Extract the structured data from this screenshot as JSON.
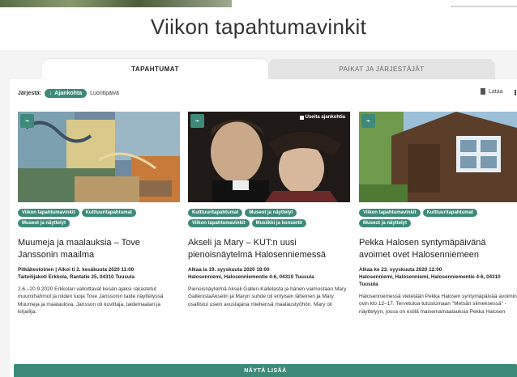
{
  "header": {
    "title": "Viikon tapahtumavinkit"
  },
  "tabs": [
    {
      "label": "TAPAHTUMAT",
      "active": true
    },
    {
      "label": "PAIKAT JA JÄRJESTÄJÄT",
      "active": false
    }
  ],
  "sort": {
    "label": "Järjestä:",
    "active_option": "Ajankohta",
    "other_option": "Luontipäivä"
  },
  "download": {
    "label": "Lataa"
  },
  "cards": [
    {
      "tags": [
        "Viikon tapahtumavinkit",
        "Kulttuuritapahtumat",
        "Museot ja näyttelyt"
      ],
      "title": "Muumeja ja maalauksia – Tove Janssonin maailma",
      "when": "Pitkäkestoinen | Alkoi ti 2. kesäkuuta 2020 11:00",
      "where": "Taiteilijakoti Erkkola, Rantatie 25, 04310 Tuusula",
      "description": "2.6.–20.9.2020 Erkkolan valloittavat kesän ajaksi rakastetut muumihahmot ja niiden luoja Tove Janssonin taide näyttelyssä Muumeja ja maalauksia. Jansson oli kuvittaja, taidemaalari ja kirjailija.",
      "badge": ""
    },
    {
      "tags": [
        "Kulttuuritapahtumat",
        "Museot ja näyttelyt",
        "Viikon tapahtumavinkit",
        "Musiikki ja konsertit"
      ],
      "title": "Akseli ja Mary – KUT:n uusi pienoisnäytelmä Halosenniemessä",
      "when": "Alkaa la 19. syyskuuta 2020 18:00",
      "where": "Halosenniemi, Halosenniementie 4-6, 04310 Tuusula",
      "description": "Pienoisnäytelmä Akseli Gallen-Kallelasta ja hänen vaimostaan Mary GallénistaAkselin ja Maryn suhde oli erityisen läheinen ja Mary osallistui usein avustajana miehensä maalaustyöhön. Mary oli",
      "badge": "Useita ajankohtia"
    },
    {
      "tags": [
        "Viikon tapahtumavinkit",
        "Kulttuuritapahtumat",
        "Museot ja näyttelyt"
      ],
      "title": "Pekka Halosen syntymäpäivänä avoimet ovet Halosenniemeen",
      "when": "Alkaa ke 23. syyskuuta 2020 12:00",
      "where": "Halosenniemi, Halosenniemi, Halosenniementie 4-6, 04310 Tuusula",
      "description": "Halosenniemessä vietetään Pekka Halosen syntymäpäivää avoimin ovin klo 12–17. Tervetuloa tutustumaan \"Metsän siimeksessä\" -näyttelyyn, jossa on esillä maisemamaalauksia Pekka Halosen",
      "badge": ""
    }
  ],
  "more_button": {
    "label": "NÄYTÄ LISÄÄ"
  },
  "colors": {
    "accent": "#3d8a7a",
    "background": "#f4f4f4"
  }
}
